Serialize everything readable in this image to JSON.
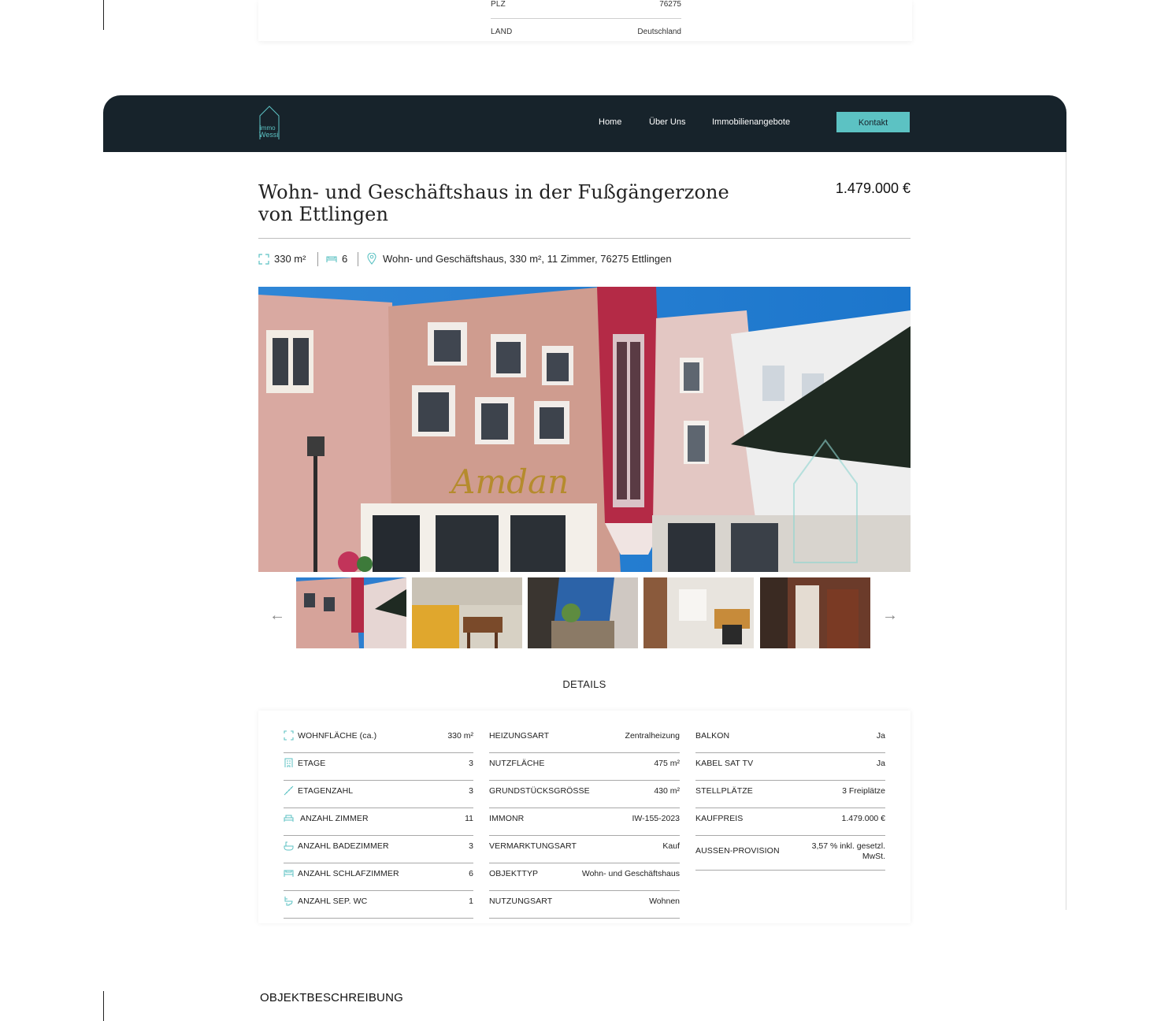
{
  "top_card": {
    "rows": [
      {
        "key": "PLZ",
        "value": "76275"
      },
      {
        "key": "LAND",
        "value": "Deutschland"
      }
    ]
  },
  "header": {
    "logo_text_1": "immo",
    "logo_text_2": "Wessi",
    "nav": [
      "Home",
      "Über Uns",
      "Immobilienangebote"
    ],
    "contact_label": "Kontakt",
    "background": "#17232b",
    "accent": "#5cc2c3"
  },
  "listing": {
    "title": "Wohn- und Geschäftshaus in der Fußgängerzone von Ettlingen",
    "price": "1.479.000 €",
    "area": "330 m²",
    "bedrooms": "6",
    "address": "Wohn- und Geschäftshaus, 330 m², 11 Zimmer, 76275 Ettlingen"
  },
  "gallery": {
    "prev_icon": "arrow-left-icon",
    "next_icon": "arrow-right-icon",
    "thumbnail_count": 5
  },
  "details": {
    "heading": "DETAILS",
    "col1": [
      {
        "icon": "area-icon",
        "key": "WOHNFLÄCHE (ca.)",
        "value": "330 m²"
      },
      {
        "icon": "building-icon",
        "key": "ETAGE",
        "value": "3"
      },
      {
        "icon": "stairs-icon",
        "key": "ETAGENZAHL",
        "value": "3"
      },
      {
        "icon": "sofa-icon",
        "key": "ANZAHL ZIMMER",
        "value": "11"
      },
      {
        "icon": "bathtub-icon",
        "key": "ANZAHL BADEZIMMER",
        "value": "3"
      },
      {
        "icon": "bed-icon",
        "key": "ANZAHL SCHLAFZIMMER",
        "value": "6"
      },
      {
        "icon": "toilet-icon",
        "key": "ANZAHL SEP. WC",
        "value": "1"
      }
    ],
    "col2": [
      {
        "key": "HEIZUNGSART",
        "value": "Zentralheizung"
      },
      {
        "key": "NUTZFLÄCHE",
        "value": "475 m²"
      },
      {
        "key": "GRUNDSTÜCKSGRÖSSE",
        "value": "430 m²"
      },
      {
        "key": "IMMONR",
        "value": "IW-155-2023"
      },
      {
        "key": "VERMARKTUNGSART",
        "value": "Kauf"
      },
      {
        "key": "OBJEKTTYP",
        "value": "Wohn- und Geschäftshaus"
      },
      {
        "key": "NUTZUNGSART",
        "value": "Wohnen"
      }
    ],
    "col3": [
      {
        "key": "BALKON",
        "value": "Ja"
      },
      {
        "key": "KABEL SAT TV",
        "value": "Ja"
      },
      {
        "key": "STELLPLÄTZE",
        "value": "3 Freiplätze"
      },
      {
        "key": "KAUFPREIS",
        "value": "1.479.000 €"
      },
      {
        "key": "AUSSEN-PROVISION",
        "value": "3,57 % inkl. gesetzl. MwSt."
      }
    ]
  },
  "description": {
    "heading": "OBJEKTBESCHREIBUNG"
  }
}
